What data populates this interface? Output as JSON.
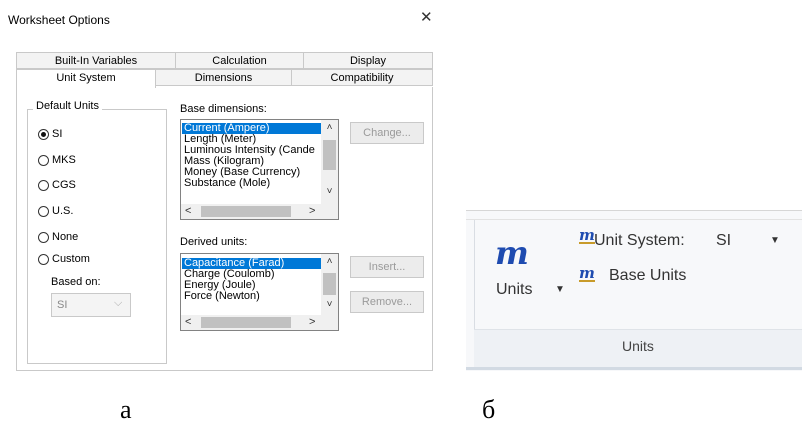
{
  "dialog": {
    "title": "Worksheet Options",
    "close_glyph": "✕",
    "tabs_back": [
      "Built-In Variables",
      "Calculation",
      "Display"
    ],
    "tabs_front": [
      "Unit System",
      "Dimensions",
      "Compatibility"
    ],
    "active_tab": "Unit System",
    "default_units": {
      "legend": "Default Units",
      "options": [
        "SI",
        "MKS",
        "CGS",
        "U.S.",
        "None",
        "Custom"
      ],
      "selected": "SI",
      "based_on_label": "Based on:",
      "based_on_value": "SI"
    },
    "base_dimensions": {
      "label": "Base dimensions:",
      "items": [
        "Current (Ampere)",
        "Length (Meter)",
        "Luminous Intensity (Cande",
        "Mass (Kilogram)",
        "Money (Base Currency)",
        "Substance (Mole)"
      ],
      "selected_index": 0,
      "change_button": "Change..."
    },
    "derived_units": {
      "label": "Derived units:",
      "items": [
        "Capacitance (Farad)",
        "Charge (Coulomb)",
        "Energy (Joule)",
        "Force (Newton)"
      ],
      "selected_index": 0,
      "insert_button": "Insert...",
      "remove_button": "Remove..."
    }
  },
  "ribbon": {
    "big_icon_glyph": "m",
    "units_button_label": "Units",
    "unit_system_label": "Unit System:",
    "unit_system_value": "SI",
    "base_units_label": "Base Units",
    "group_title": "Units"
  },
  "captions": {
    "a": "a",
    "b": "б"
  }
}
